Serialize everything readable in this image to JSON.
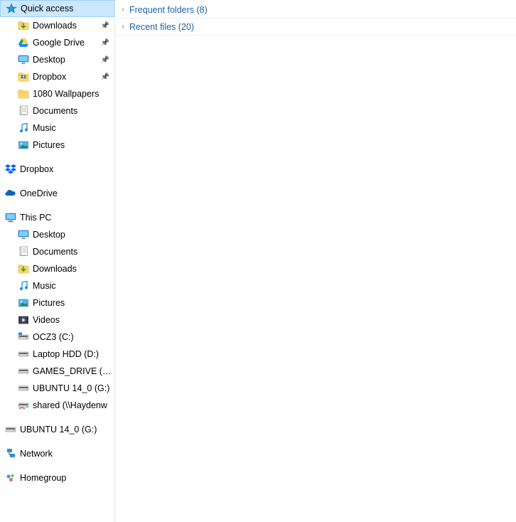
{
  "sidebar": {
    "quickAccess": {
      "label": "Quick access",
      "items": [
        {
          "label": "Downloads",
          "icon": "download",
          "pinned": true
        },
        {
          "label": "Google Drive",
          "icon": "gdrive",
          "pinned": true
        },
        {
          "label": "Desktop",
          "icon": "desktop",
          "pinned": true
        },
        {
          "label": "Dropbox",
          "icon": "dropbox-folder",
          "pinned": true
        },
        {
          "label": "1080 Wallpapers",
          "icon": "folder",
          "pinned": false
        },
        {
          "label": "Documents",
          "icon": "documents",
          "pinned": false
        },
        {
          "label": "Music",
          "icon": "music",
          "pinned": false
        },
        {
          "label": "Pictures",
          "icon": "pictures",
          "pinned": false
        }
      ]
    },
    "dropbox": {
      "label": "Dropbox"
    },
    "onedrive": {
      "label": "OneDrive"
    },
    "thisPC": {
      "label": "This PC",
      "items": [
        {
          "label": "Desktop",
          "icon": "desktop"
        },
        {
          "label": "Documents",
          "icon": "documents"
        },
        {
          "label": "Downloads",
          "icon": "download"
        },
        {
          "label": "Music",
          "icon": "music"
        },
        {
          "label": "Pictures",
          "icon": "pictures"
        },
        {
          "label": "Videos",
          "icon": "videos"
        },
        {
          "label": "OCZ3 (C:)",
          "icon": "disk-os"
        },
        {
          "label": "Laptop HDD (D:)",
          "icon": "disk"
        },
        {
          "label": "GAMES_DRIVE (E:)",
          "icon": "disk"
        },
        {
          "label": "UBUNTU 14_0 (G:)",
          "icon": "disk"
        },
        {
          "label": "shared (\\\\Haydenw",
          "icon": "netdrive"
        }
      ]
    },
    "ubuntuDrive": {
      "label": "UBUNTU 14_0 (G:)"
    },
    "network": {
      "label": "Network"
    },
    "homegroup": {
      "label": "Homegroup"
    }
  },
  "content": {
    "groups": [
      {
        "label": "Frequent folders (8)"
      },
      {
        "label": "Recent files (20)"
      }
    ]
  }
}
